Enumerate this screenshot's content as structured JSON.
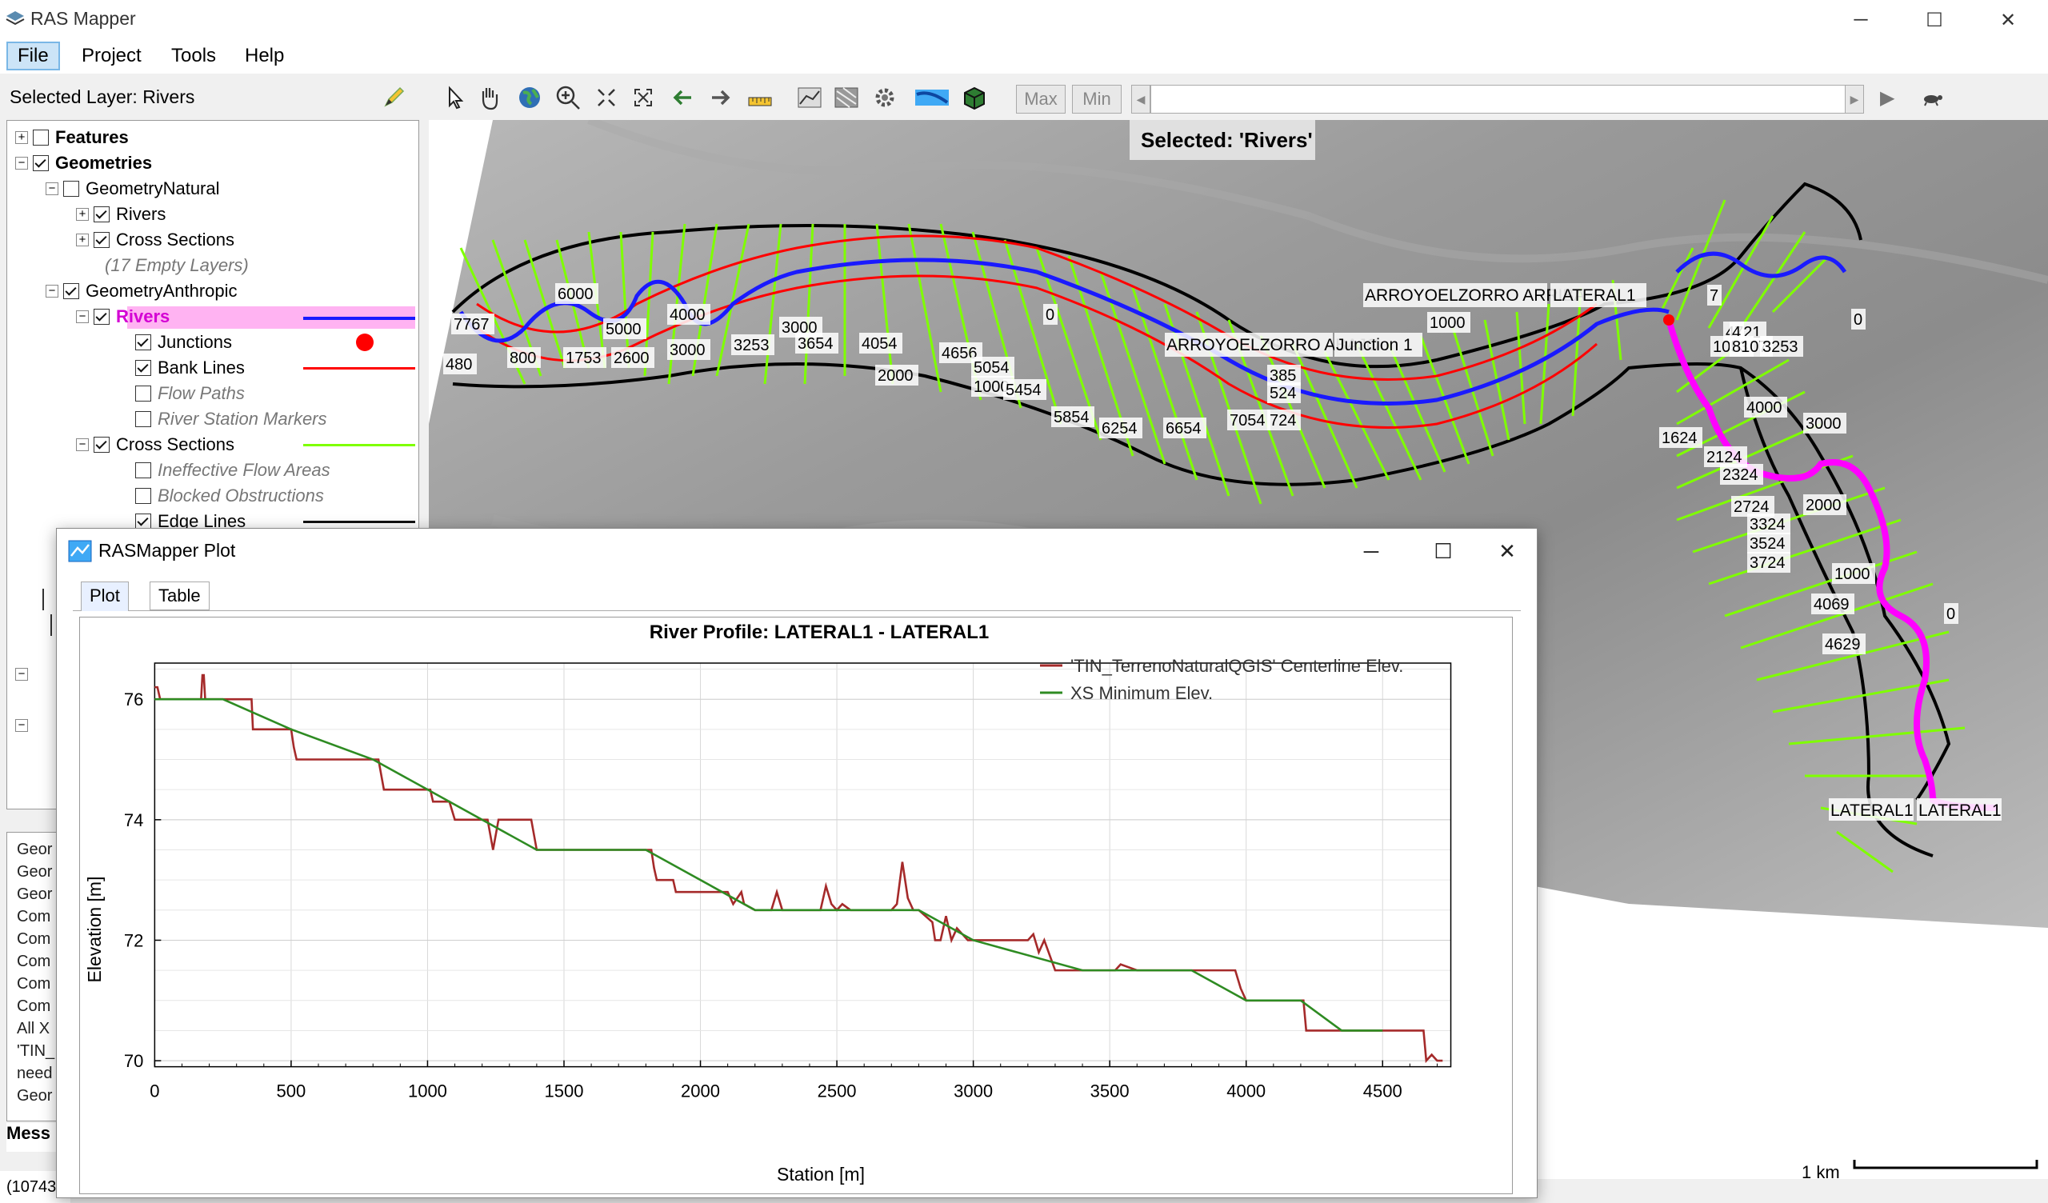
{
  "window": {
    "title": "RAS Mapper",
    "minimize": "─",
    "maximize": "☐",
    "close": "✕"
  },
  "menu": {
    "items": [
      "File",
      "Project",
      "Tools",
      "Help"
    ]
  },
  "selected_layer_label": "Selected Layer: Rivers",
  "toolbar": {
    "max_label": "Max",
    "min_label": "Min",
    "left_arrow": "◀",
    "right_arrow": "▶",
    "play": "▶"
  },
  "tree": {
    "features": "Features",
    "geometries": "Geometries",
    "geometry_natural": "GeometryNatural",
    "rivers": "Rivers",
    "cross_sections": "Cross Sections",
    "empty_layers": "(17 Empty Layers)",
    "geometry_anthropic": "GeometryAnthropic",
    "rivers_sel": "Rivers",
    "junctions": "Junctions",
    "bank_lines": "Bank Lines",
    "flow_paths": "Flow Paths",
    "river_station_markers": "River Station Markers",
    "cross_sections2": "Cross Sections",
    "ineffective": "Ineffective Flow Areas",
    "blocked": "Blocked Obstructions",
    "edge_lines": "Edge Lines"
  },
  "messages": [
    "Geor",
    "Geor",
    "Geor",
    "Com",
    "Com",
    "Com",
    "Com",
    "Com",
    "All X",
    "'TIN_",
    "need",
    "Geor"
  ],
  "messages_tab": "Mess",
  "status_left": "(10743",
  "map": {
    "selected_banner": "Selected: 'Rivers'",
    "scale_label": "1 km",
    "labels": {
      "reach_arriba": "ARROYOELZORRO ARRIBA",
      "lateral_top": "LATERAL1",
      "reach_abajo": "ARROYOELZORRO ABAJO",
      "junction": "Junction 1",
      "lateral_bottom": "LATERAL1",
      "lateral_bottom2": "LATERAL1"
    },
    "stations": [
      "7767",
      "6000",
      "5000",
      "4000",
      "3000",
      "2000",
      "1000",
      "0",
      "480",
      "800",
      "1753",
      "2600",
      "3000",
      "3253",
      "3654",
      "4054",
      "4656",
      "5054",
      "5454",
      "5854",
      "6254",
      "6654",
      "7054",
      "724",
      "524",
      "385",
      "1000",
      "4721",
      "4",
      "1053",
      "8107",
      "3253",
      "1624",
      "2124",
      "2324",
      "2724",
      "3324",
      "3524",
      "3724",
      "4000",
      "3000",
      "2000",
      "1000",
      "0",
      "4069",
      "4629",
      "7",
      "0"
    ]
  },
  "plot": {
    "window_title": "RASMapper Plot",
    "tabs": [
      "Plot",
      "Table"
    ],
    "minimize": "─",
    "maximize": "☐",
    "close": "✕"
  },
  "chart_data": {
    "type": "line",
    "title": "River Profile: LATERAL1 - LATERAL1",
    "xlabel": "Station [m]",
    "ylabel": "Elevation [m]",
    "xlim": [
      0,
      4750
    ],
    "ylim": [
      69.9,
      76.6
    ],
    "xticks": [
      0,
      500,
      1000,
      1500,
      2000,
      2500,
      3000,
      3500,
      4000,
      4500
    ],
    "yticks": [
      70,
      72,
      74,
      76
    ],
    "grid": true,
    "legend_position": "top-right",
    "series": [
      {
        "name": "'TIN_TerrenoNaturalQGIS' Centerline Elev.",
        "color": "#a52a2a",
        "x": [
          0,
          10,
          20,
          170,
          175,
          180,
          185,
          350,
          355,
          360,
          365,
          500,
          510,
          520,
          780,
          790,
          800,
          820,
          840,
          1000,
          1010,
          1020,
          1080,
          1100,
          1140,
          1200,
          1220,
          1240,
          1260,
          1300,
          1360,
          1380,
          1400,
          1420,
          1480,
          1500,
          1520,
          1800,
          1820,
          1830,
          1840,
          1900,
          1910,
          2000,
          2100,
          2120,
          2150,
          2160,
          2200,
          2240,
          2260,
          2280,
          2300,
          2400,
          2420,
          2440,
          2460,
          2480,
          2500,
          2520,
          2550,
          2560,
          2580,
          2600,
          2680,
          2700,
          2720,
          2740,
          2760,
          2780,
          2800,
          2850,
          2860,
          2880,
          2900,
          2920,
          2940,
          2960,
          2980,
          3000,
          3100,
          3200,
          3220,
          3240,
          3260,
          3300,
          3350,
          3400,
          3450,
          3500,
          3520,
          3540,
          3600,
          3620,
          3640,
          3700,
          3720,
          3740,
          3800,
          3900,
          3950,
          3960,
          3980,
          4000,
          4100,
          4180,
          4200,
          4210,
          4220,
          4300,
          4350,
          4400,
          4450,
          4500,
          4600,
          4650,
          4660,
          4680,
          4700,
          4720
        ],
        "y": [
          76.2,
          76.2,
          76,
          76,
          76.4,
          76.4,
          76,
          76,
          76,
          75.5,
          75.5,
          75.5,
          75.2,
          75,
          75,
          75,
          75,
          75,
          74.5,
          74.5,
          74.5,
          74.3,
          74.3,
          74,
          74,
          74,
          74,
          73.5,
          74,
          74,
          74,
          74,
          73.5,
          73.5,
          73.5,
          73.5,
          73.5,
          73.5,
          73.5,
          73.2,
          73,
          73,
          72.8,
          72.8,
          72.8,
          72.6,
          72.8,
          72.6,
          72.5,
          72.5,
          72.5,
          72.8,
          72.5,
          72.5,
          72.5,
          72.5,
          72.9,
          72.6,
          72.5,
          72.6,
          72.5,
          72.5,
          72.5,
          72.5,
          72.5,
          72.5,
          72.6,
          73.3,
          72.7,
          72.5,
          72.5,
          72.3,
          72,
          72,
          72.4,
          72,
          72.2,
          72.1,
          72,
          72,
          72,
          72,
          72.1,
          71.8,
          72,
          71.5,
          71.5,
          71.5,
          71.5,
          71.5,
          71.5,
          71.6,
          71.5,
          71.5,
          71.5,
          71.5,
          71.5,
          71.5,
          71.5,
          71.5,
          71.5,
          71.5,
          71.2,
          71,
          71,
          71,
          71,
          71,
          70.5,
          70.5,
          70.5,
          70.5,
          70.5,
          70.5,
          70.5,
          70.5,
          70,
          70.1,
          70,
          70
        ]
      },
      {
        "name": "XS Minimum Elev.",
        "color": "#2e8b22",
        "x": [
          0,
          250,
          500,
          800,
          1000,
          1400,
          1800,
          2200,
          2600,
          2800,
          3000,
          3400,
          3600,
          3800,
          4000,
          4200,
          4350,
          4500
        ],
        "y": [
          76,
          76,
          75.5,
          75,
          74.5,
          73.5,
          73.5,
          72.5,
          72.5,
          72.5,
          72,
          71.5,
          71.5,
          71.5,
          71,
          71,
          70.5,
          70.5
        ]
      }
    ]
  }
}
